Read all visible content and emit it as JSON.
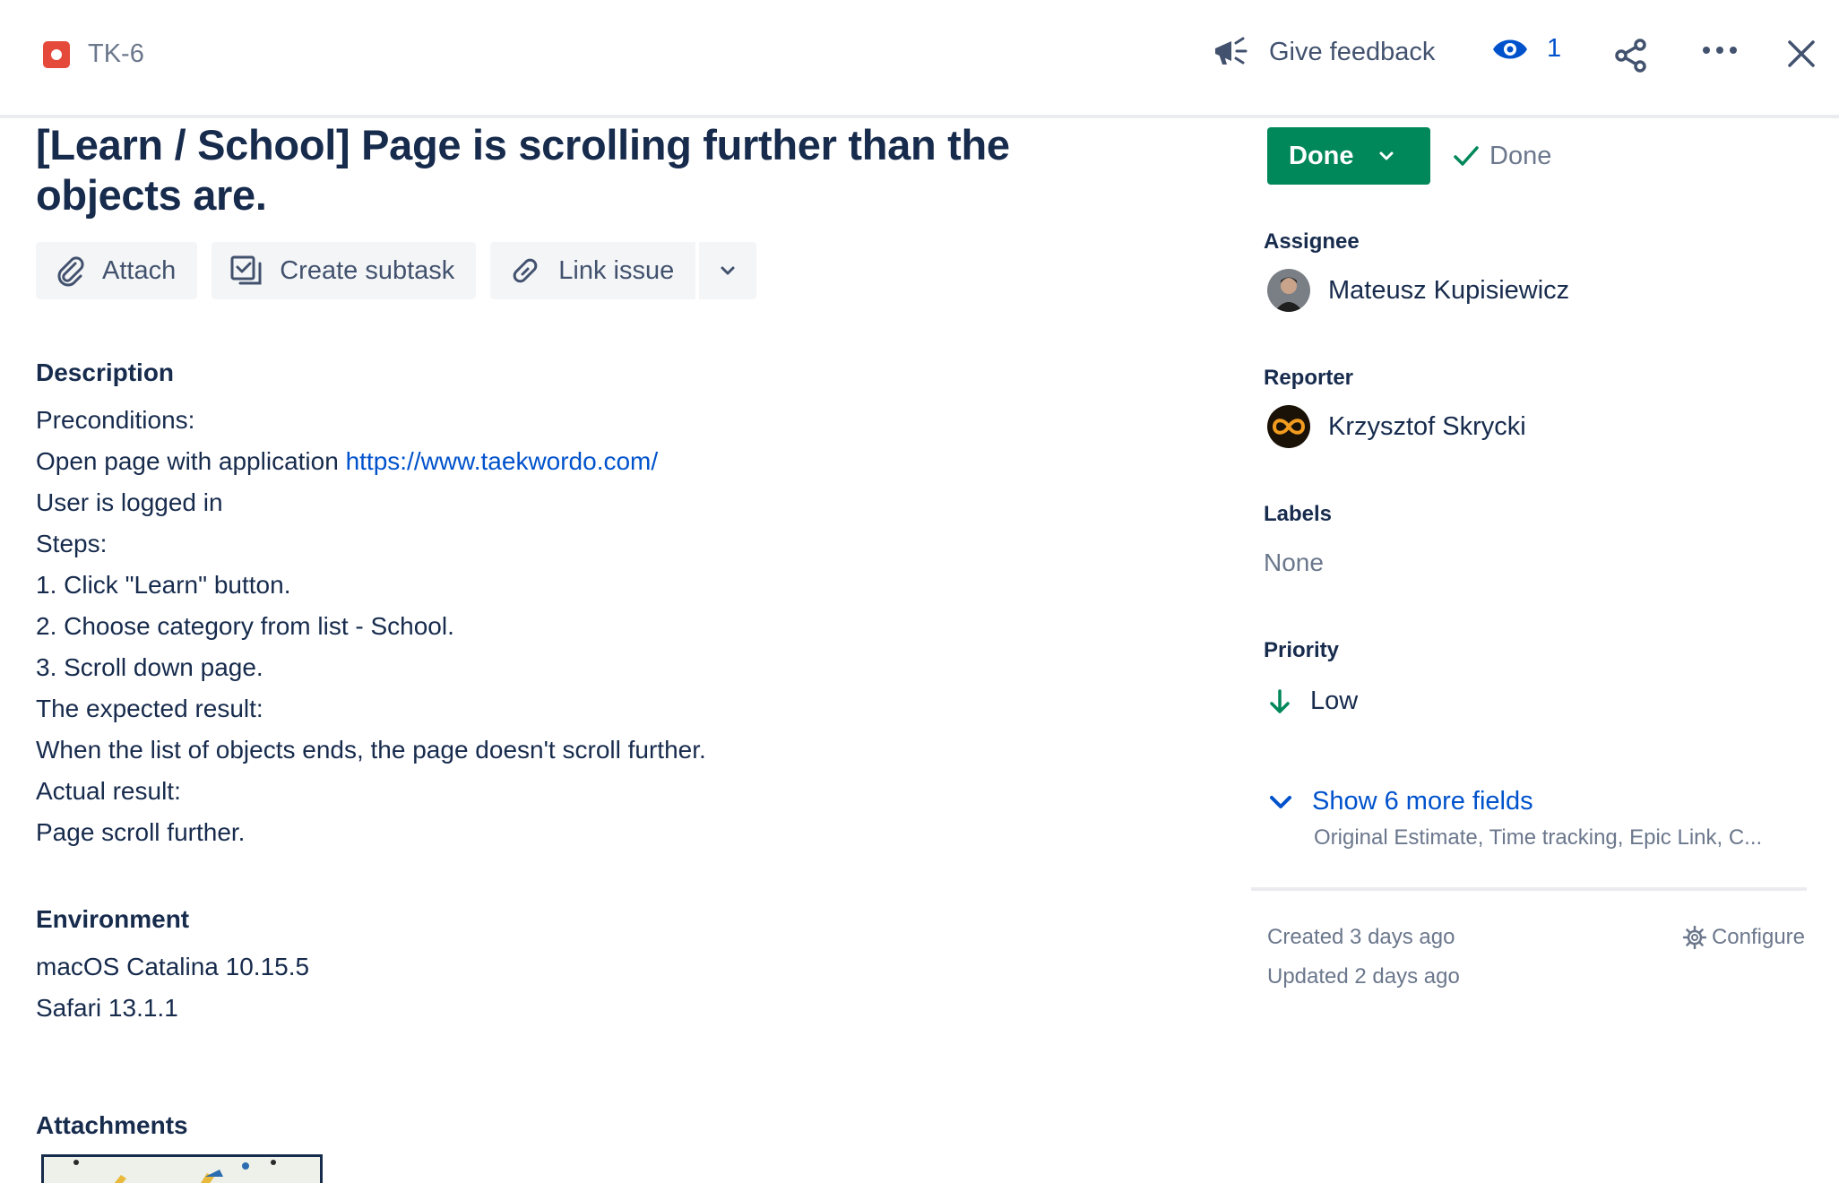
{
  "header": {
    "issue_key": "TK-6",
    "issue_type_icon": "bug-icon",
    "feedback_label": "Give feedback",
    "watch_count": "1"
  },
  "issue": {
    "title": "[Learn / School] Page is scrolling further than the objects are."
  },
  "actions": {
    "attach": "Attach",
    "create_subtask": "Create subtask",
    "link_issue": "Link issue"
  },
  "description": {
    "heading": "Description",
    "preconditions": "Preconditions:",
    "open_page_prefix": "Open page with application ",
    "link": "https://www.taekwordo.com/",
    "lines": [
      "User is logged in",
      "Steps:",
      "1. Click \"Learn\" button.",
      "2. Choose category from list - School.",
      "3. Scroll down page.",
      "The expected result:",
      "When the list of objects ends, the page doesn't scroll further.",
      "Actual result:",
      "Page scroll further."
    ]
  },
  "environment": {
    "heading": "Environment",
    "lines": [
      "macOS Catalina 10.15.5",
      "Safari 13.1.1"
    ]
  },
  "attachments": {
    "heading": "Attachments"
  },
  "sidebar": {
    "status_button": "Done",
    "status_resolution": "Done",
    "assignee_label": "Assignee",
    "assignee": "Mateusz Kupisiewicz",
    "reporter_label": "Reporter",
    "reporter": "Krzysztof Skrycki",
    "labels_label": "Labels",
    "labels_value": "None",
    "priority_label": "Priority",
    "priority_value": "Low",
    "show_more": "Show 6 more fields",
    "show_more_sub": "Original Estimate, Time tracking, Epic Link, C...",
    "created": "Created 3 days ago",
    "updated": "Updated 2 days ago",
    "configure": "Configure"
  },
  "colors": {
    "primary_text": "#172b4d",
    "link": "#0052cc",
    "status_green": "#00875a",
    "bug_red": "#e5493a"
  }
}
